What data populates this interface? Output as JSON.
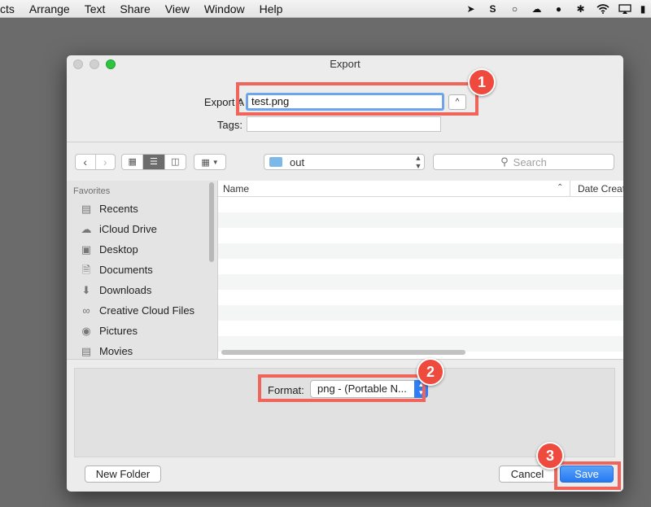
{
  "menubar": {
    "items": [
      "cts",
      "Arrange",
      "Text",
      "Share",
      "View",
      "Window",
      "Help"
    ],
    "tray_icons": [
      "arrow-icon",
      "s-icon",
      "circle-icon",
      "cloud-sync-icon",
      "evernote-icon",
      "bluetooth-icon",
      "wifi-icon",
      "airplay-icon",
      "battery-icon"
    ]
  },
  "dialog": {
    "title": "Export",
    "export_as_label": "Export A",
    "colon": ":",
    "export_as_value": "test.png",
    "expand_glyph": "^",
    "tags_label": "Tags:",
    "tags_value": "",
    "location": "out",
    "search_placeholder": "Search",
    "sidebar": {
      "title": "Favorites",
      "items": [
        {
          "label": "Recents",
          "icon": "recents-icon"
        },
        {
          "label": "iCloud Drive",
          "icon": "cloud-icon"
        },
        {
          "label": "Desktop",
          "icon": "desktop-icon"
        },
        {
          "label": "Documents",
          "icon": "documents-icon"
        },
        {
          "label": "Downloads",
          "icon": "downloads-icon"
        },
        {
          "label": "Creative Cloud Files",
          "icon": "creative-cloud-icon"
        },
        {
          "label": "Pictures",
          "icon": "camera-icon"
        },
        {
          "label": "Movies",
          "icon": "film-icon"
        }
      ]
    },
    "columns": {
      "name": "Name",
      "date": "Date Creat"
    },
    "format_label": "Format:",
    "format_value": "png - (Portable N...",
    "new_folder_button": "New Folder",
    "cancel_button": "Cancel",
    "save_button": "Save"
  },
  "callouts": [
    "1",
    "2",
    "3"
  ],
  "colors": {
    "callout": "#ee4a3e",
    "accent": "#2579f2"
  }
}
